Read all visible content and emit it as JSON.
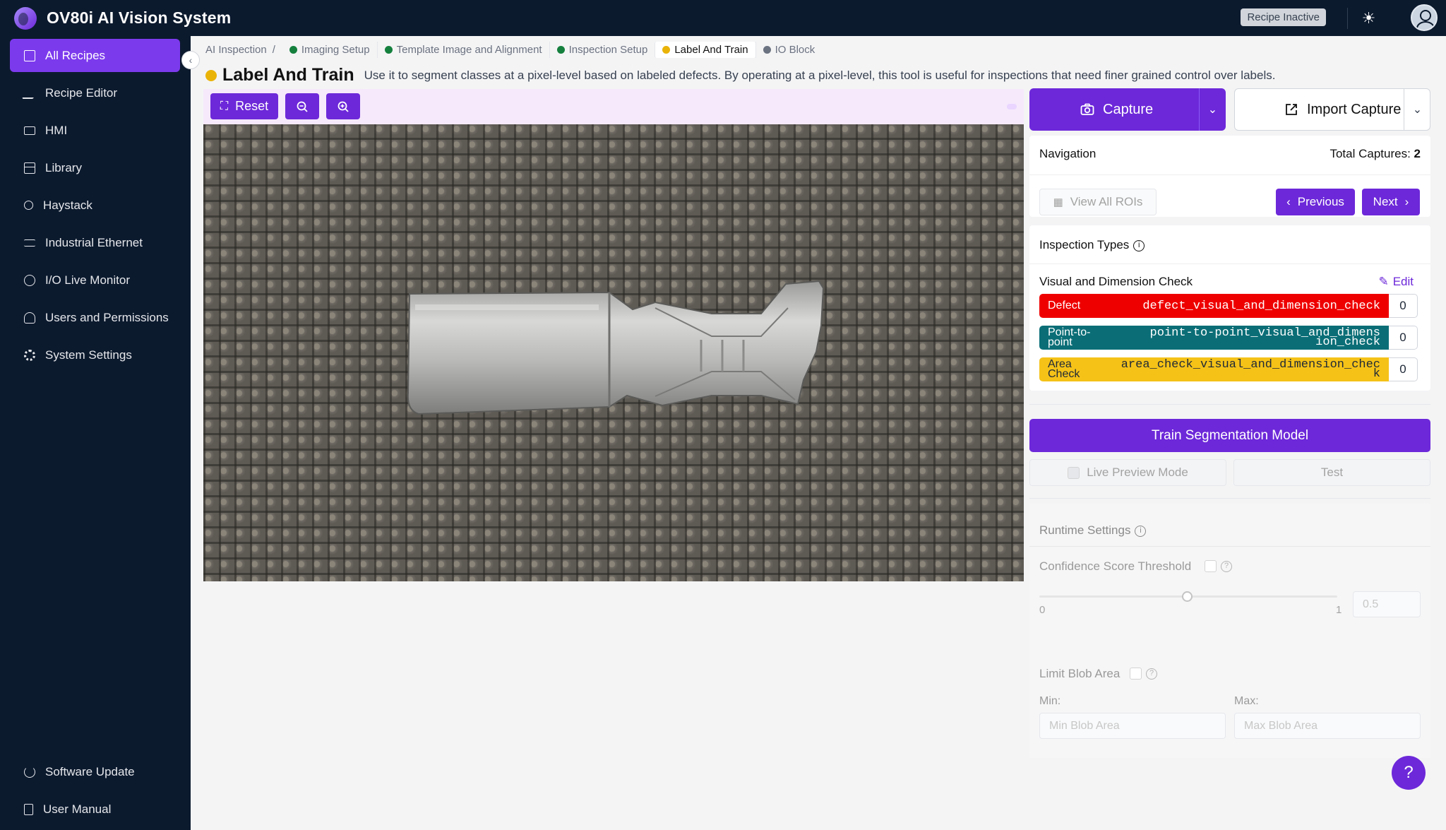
{
  "app": {
    "title": "OV80i AI Vision System",
    "status_badge": "Recipe Inactive"
  },
  "sidebar": {
    "items": [
      {
        "label": "All Recipes",
        "icon": "document-icon"
      },
      {
        "label": "Recipe Editor",
        "icon": "pen-icon"
      },
      {
        "label": "HMI",
        "icon": "video-icon"
      },
      {
        "label": "Library",
        "icon": "table-icon"
      },
      {
        "label": "Haystack",
        "icon": "search-icon"
      },
      {
        "label": "Industrial Ethernet",
        "icon": "network-icon"
      },
      {
        "label": "I/O Live Monitor",
        "icon": "monitor-icon"
      },
      {
        "label": "Users and Permissions",
        "icon": "user-icon"
      },
      {
        "label": "System Settings",
        "icon": "gear-icon"
      }
    ],
    "bottom": [
      {
        "label": "Software Update",
        "icon": "refresh-icon"
      },
      {
        "label": "User Manual",
        "icon": "book-icon"
      }
    ]
  },
  "breadcrumb": {
    "root": "AI Inspection",
    "separator": "/",
    "steps": [
      {
        "label": "Imaging Setup",
        "color": "#15803d"
      },
      {
        "label": "Template Image and Alignment",
        "color": "#15803d"
      },
      {
        "label": "Inspection Setup",
        "color": "#15803d"
      },
      {
        "label": "Label And Train",
        "color": "#eab308"
      },
      {
        "label": "IO Block",
        "color": "#6b7280"
      }
    ]
  },
  "header": {
    "title": "Label And Train",
    "description": "Use it to segment classes at a pixel-level based on labeled defects. By operating at a pixel-level, this tool is useful for inspections that need finer grained control over labels."
  },
  "toolbar": {
    "reset_label": "Reset"
  },
  "capture": {
    "capture_label": "Capture",
    "import_label": "Import Capture"
  },
  "navigation": {
    "title": "Navigation",
    "total_label": "Total Captures:",
    "total_value": "2",
    "view_all_label": "View All ROIs",
    "previous_label": "Previous",
    "next_label": "Next"
  },
  "inspection_types": {
    "title": "Inspection Types",
    "group_name": "Visual and Dimension Check",
    "edit_label": "Edit",
    "classes": [
      {
        "name": "Defect",
        "code": "defect_visual_and_dimension_check",
        "count": "0",
        "color": "#ef0000",
        "text_color": "#ffffff"
      },
      {
        "name": "Point-to-point",
        "code": "point-to-point_visual_and_dimension_check",
        "count": "0",
        "color": "#0b6e77",
        "text_color": "#ffffff"
      },
      {
        "name": "Area Check",
        "code": "area_check_visual_and_dimension_check",
        "count": "0",
        "color": "#f5c218",
        "text_color": "#1f2937"
      }
    ]
  },
  "train": {
    "train_label": "Train Segmentation Model",
    "live_preview_label": "Live Preview Mode",
    "test_label": "Test"
  },
  "runtime": {
    "title": "Runtime Settings",
    "confidence_label": "Confidence Score Threshold",
    "slider_min": "0",
    "slider_max": "1",
    "slider_value": "0.5",
    "limit_blob_label": "Limit Blob Area",
    "min_label": "Min:",
    "max_label": "Max:",
    "min_placeholder": "Min Blob Area",
    "max_placeholder": "Max Blob Area"
  },
  "colors": {
    "accent": "#6d28d9",
    "sidebar": "#0c1a2e"
  }
}
